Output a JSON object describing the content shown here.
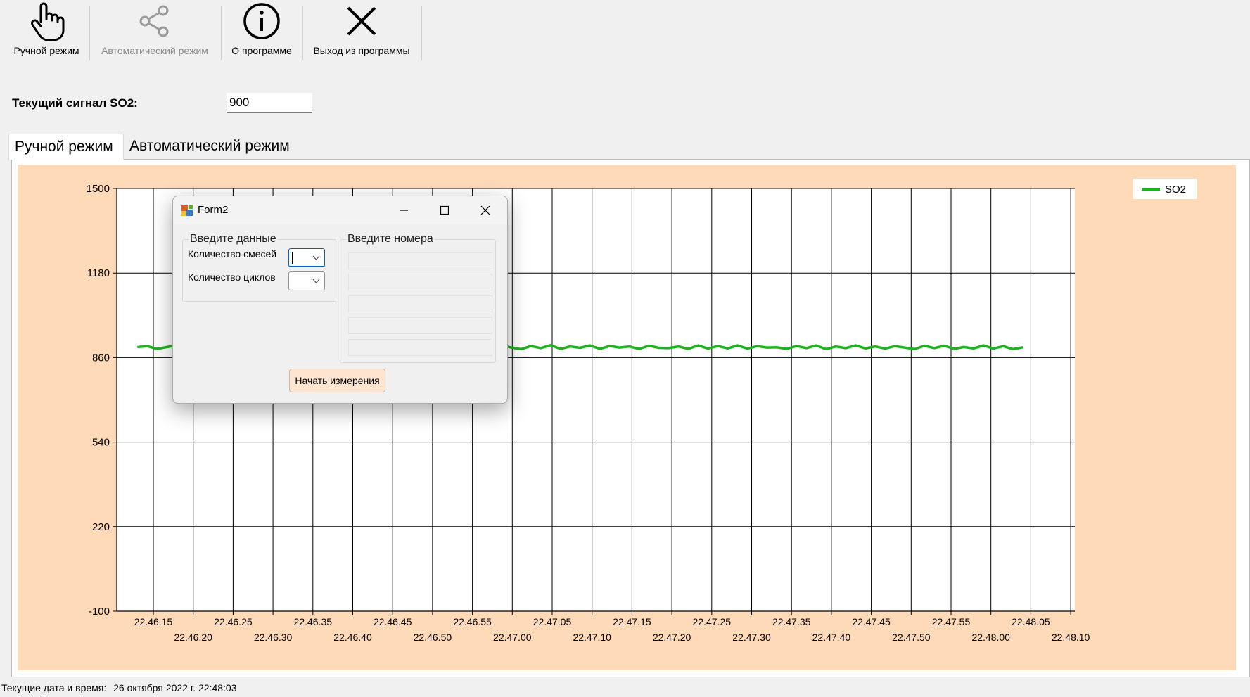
{
  "toolbar": {
    "items": [
      {
        "label": "Ручной режим",
        "icon": "hand-pointer-icon",
        "enabled": true
      },
      {
        "label": "Автоматический режим",
        "icon": "share-nodes-icon",
        "enabled": false
      },
      {
        "label": "О программе",
        "icon": "info-icon",
        "enabled": true
      },
      {
        "label": "Выход из программы",
        "icon": "close-x-icon",
        "enabled": true
      }
    ]
  },
  "signal": {
    "label": "Текущий сигнал SO2:",
    "value": "900"
  },
  "tabs": [
    {
      "label": "Ручной режим",
      "active": true
    },
    {
      "label": "Автоматический режим",
      "active": false
    }
  ],
  "chart_data": {
    "type": "line",
    "background": "#ffdab9",
    "series": [
      {
        "name": "SO2",
        "color": "#1db31d",
        "values": [
          900,
          903,
          893,
          900,
          906,
          898,
          893,
          899,
          907,
          896,
          905,
          892,
          903,
          897,
          906,
          895,
          903,
          894,
          904,
          895,
          899,
          902,
          892,
          905,
          896,
          906,
          893,
          902,
          896,
          907,
          894,
          903,
          893,
          905,
          896,
          899,
          895,
          906,
          898,
          892,
          904,
          896,
          907,
          893,
          902,
          897,
          906,
          893,
          904,
          898,
          902,
          893,
          905,
          897,
          896,
          902,
          893,
          906,
          894,
          904,
          895,
          906,
          894,
          903,
          898,
          899,
          893,
          904,
          896,
          906,
          892,
          902,
          896,
          906,
          895,
          902,
          894,
          903,
          898,
          892,
          905,
          896,
          905,
          893,
          900,
          895,
          906,
          894,
          903,
          892,
          899
        ]
      }
    ],
    "x_start": "22.46.13",
    "x_end": "22.48.04",
    "x_tick_labels": [
      "22.46.15",
      "22.46.20",
      "22.46.25",
      "22.46.30",
      "22.46.35",
      "22.46.40",
      "22.46.45",
      "22.46.50",
      "22.46.55",
      "22.47.00",
      "22.47.05",
      "22.47.10",
      "22.47.15",
      "22.47.20",
      "22.47.25",
      "22.47.30",
      "22.47.35",
      "22.47.40",
      "22.47.45",
      "22.47.50",
      "22.47.55",
      "22.48.00",
      "22.48.05",
      "22.48.10"
    ],
    "y_tick_labels": [
      "1500",
      "1180",
      "860",
      "540",
      "220",
      "-100"
    ],
    "ylim": [
      -100,
      1500
    ],
    "grid": true,
    "legend": {
      "position": "top-right",
      "entries": [
        "SO2"
      ]
    }
  },
  "dialog": {
    "title": "Form2",
    "group_input": {
      "legend": "Введите данные",
      "mixtures_label": "Количество смесей",
      "cycles_label": "Количество циклов"
    },
    "group_numbers": {
      "legend": "Введите номера"
    },
    "start_button": "Начать измерения"
  },
  "status": {
    "label": "Текущие дата и время:",
    "value": "26 октября 2022 г.  22:48:03"
  }
}
